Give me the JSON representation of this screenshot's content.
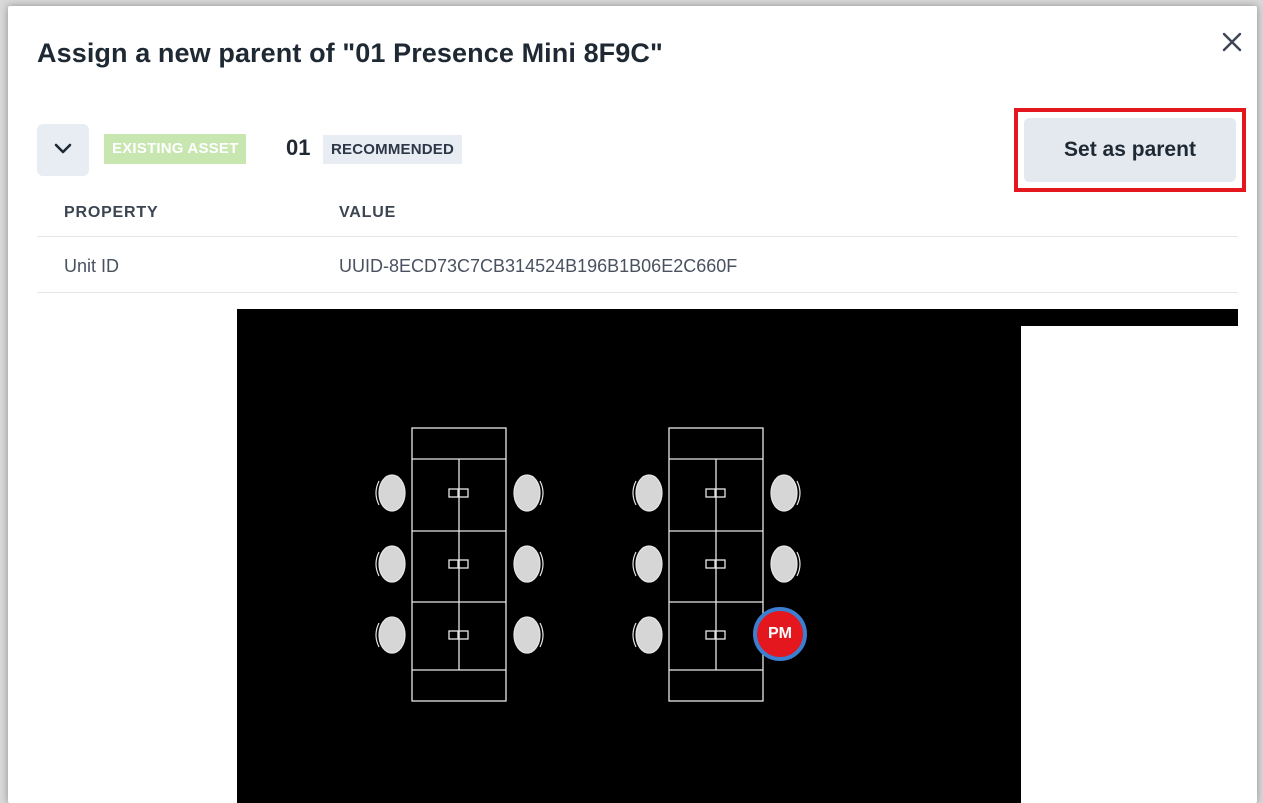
{
  "dialog": {
    "title": "Assign a new parent of \"01 Presence Mini 8F9C\"",
    "close_icon": "close-icon"
  },
  "asset": {
    "expand_icon": "chevron-down-icon",
    "existing_badge": "EXISTING ASSET",
    "name": "01",
    "recommended_badge": "RECOMMENDED",
    "set_parent_label": "Set as parent"
  },
  "table": {
    "headers": [
      "PROPERTY",
      "VALUE"
    ],
    "rows": [
      {
        "property": "Unit ID",
        "value": "UUID-8ECD73C7CB314524B196B1B06E2C660F"
      }
    ]
  },
  "floorplan": {
    "device_marker_label": "PM",
    "marker_color": "#e4161e",
    "marker_ring_color": "#3a7fd0"
  },
  "colors": {
    "highlight": "#e4161e",
    "existing_badge_bg": "#c8e6b0",
    "button_bg": "#e4e9f0"
  }
}
